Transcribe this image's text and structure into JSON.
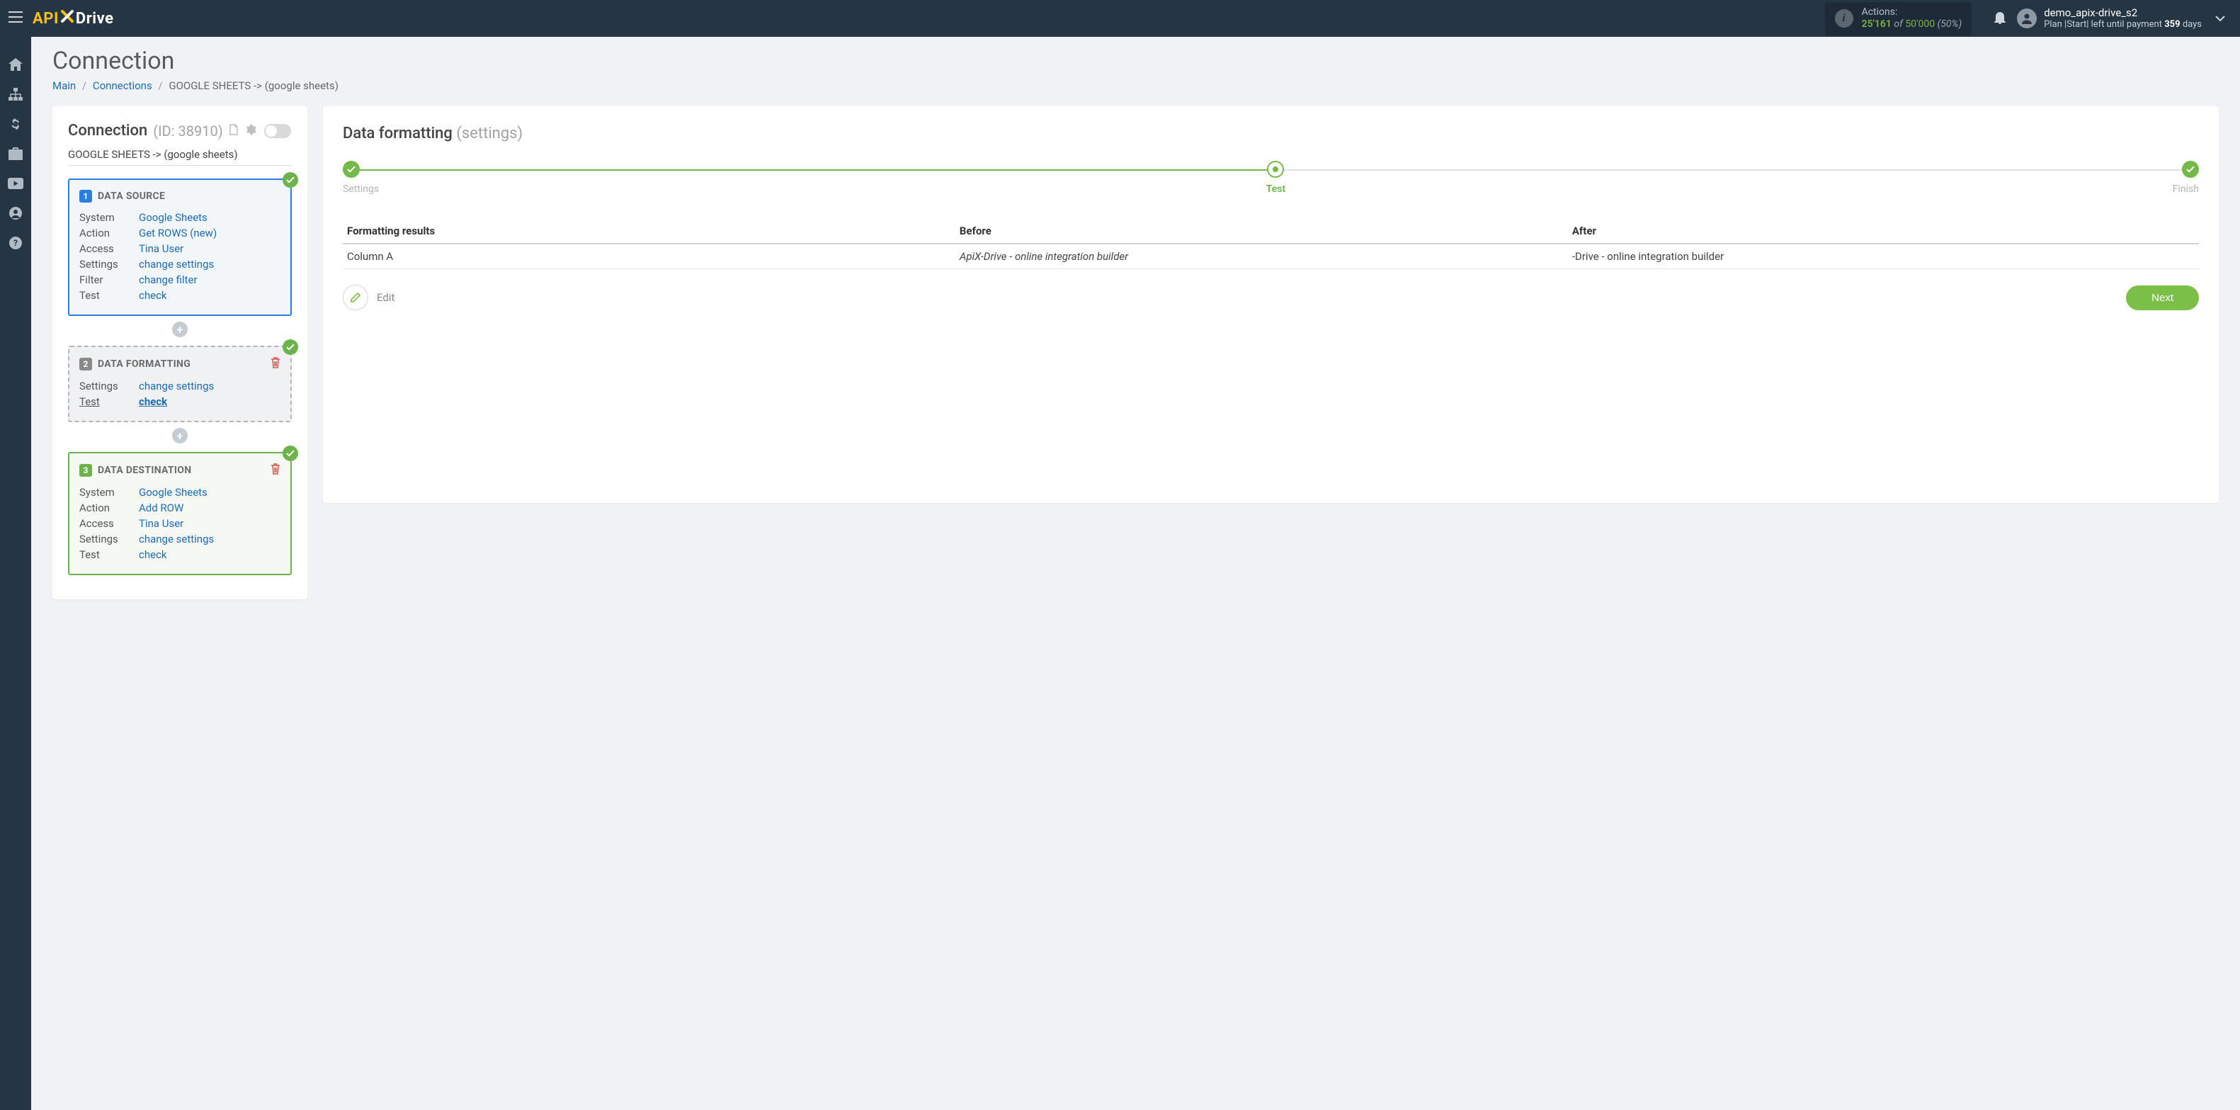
{
  "header": {
    "brand_api": "API",
    "brand_drive": "Drive",
    "actions_label": "Actions:",
    "actions_used": "25'161",
    "actions_of": "of",
    "actions_total": "50'000",
    "actions_pct": "(50%)",
    "user_name": "demo_apix-drive_s2",
    "user_plan_prefix": "Plan |Start| left until payment ",
    "user_plan_days_num": "359",
    "user_plan_days_word": " days"
  },
  "page": {
    "title": "Connection"
  },
  "breadcrumb": {
    "main": "Main",
    "connections": "Connections",
    "current": "GOOGLE SHEETS -> (google sheets)"
  },
  "left": {
    "title": "Connection",
    "id_text": "(ID: 38910)",
    "name": "GOOGLE SHEETS -> (google sheets)",
    "source": {
      "num": "1",
      "title": "DATA SOURCE",
      "rows": [
        {
          "label": "System",
          "value": "Google Sheets"
        },
        {
          "label": "Action",
          "value": "Get ROWS (new)"
        },
        {
          "label": "Access",
          "value": "Tina User"
        },
        {
          "label": "Settings",
          "value": "change settings"
        },
        {
          "label": "Filter",
          "value": "change filter"
        },
        {
          "label": "Test",
          "value": "check"
        }
      ]
    },
    "format": {
      "num": "2",
      "title": "DATA FORMATTING",
      "rows": [
        {
          "label": "Settings",
          "value": "change settings"
        },
        {
          "label": "Test",
          "value": "check"
        }
      ]
    },
    "dest": {
      "num": "3",
      "title": "DATA DESTINATION",
      "rows": [
        {
          "label": "System",
          "value": "Google Sheets"
        },
        {
          "label": "Action",
          "value": "Add ROW"
        },
        {
          "label": "Access",
          "value": "Tina User"
        },
        {
          "label": "Settings",
          "value": "change settings"
        },
        {
          "label": "Test",
          "value": "check"
        }
      ]
    },
    "plus": "+"
  },
  "right": {
    "title": "Data formatting",
    "subtitle": "(settings)",
    "steps": {
      "settings": "Settings",
      "test": "Test",
      "finish": "Finish"
    },
    "table": {
      "h1": "Formatting results",
      "h2": "Before",
      "h3": "After",
      "r1c1": "Column A",
      "r1c2": "ApiX-Drive - online integration builder",
      "r1c3": "-Drive - online integration builder"
    },
    "edit_label": "Edit",
    "next_label": "Next"
  }
}
